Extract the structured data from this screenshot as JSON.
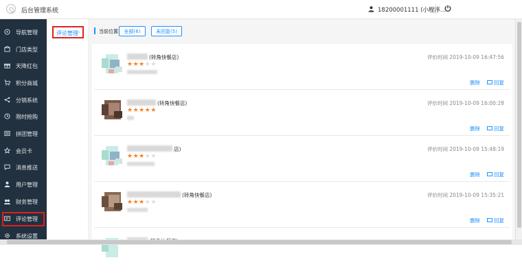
{
  "app": {
    "title": "后台管理系统"
  },
  "user": {
    "text": "18200001111 (小程序..."
  },
  "sidebar": {
    "items": [
      {
        "label": "导航管理",
        "icon": "compass-icon"
      },
      {
        "label": "门店类型",
        "icon": "store-icon"
      },
      {
        "label": "天降红包",
        "icon": "gift-icon"
      },
      {
        "label": "积分商城",
        "icon": "cart-icon"
      },
      {
        "label": "分销系统",
        "icon": "share-icon"
      },
      {
        "label": "限时抢购",
        "icon": "clock-icon"
      },
      {
        "label": "拼团管理",
        "icon": "group-icon"
      },
      {
        "label": "会员卡",
        "icon": "card-icon"
      },
      {
        "label": "消息推送",
        "icon": "message-icon"
      },
      {
        "label": "用户管理",
        "icon": "user-icon"
      },
      {
        "label": "财务管理",
        "icon": "finance-icon"
      },
      {
        "label": "评论管理",
        "icon": "comment-icon"
      },
      {
        "label": "系统设置",
        "icon": "gear-icon"
      }
    ]
  },
  "subnav": {
    "label": "评论管理"
  },
  "breadcrumb": {
    "label": "当前位置:"
  },
  "filters": {
    "all": "全部(6)",
    "unreplied": "未回复(5)"
  },
  "reviews": [
    {
      "shop": "(转角快餐店)",
      "rating": 3,
      "time": "评价时间 2019-10-09 16:47:56"
    },
    {
      "shop": "(转角快餐店)",
      "rating": 5,
      "time": "评价时间 2019-10-09 16:00:28"
    },
    {
      "shop": "店)",
      "rating": 3,
      "time": "评价时间 2019-10-09 15:48:19"
    },
    {
      "shop": "(转角快餐店)",
      "rating": 3,
      "time": "评价时间 2019-10-09 15:35:21"
    },
    {
      "shop": "转角快餐店)",
      "rating": 0,
      "time": ""
    }
  ],
  "actions": {
    "delete": "删除",
    "reply": "回复"
  },
  "colors": {
    "accent": "#1e90ff",
    "sidebar_bg": "#22313f",
    "star": "#f58220",
    "highlight": "#e02020"
  }
}
